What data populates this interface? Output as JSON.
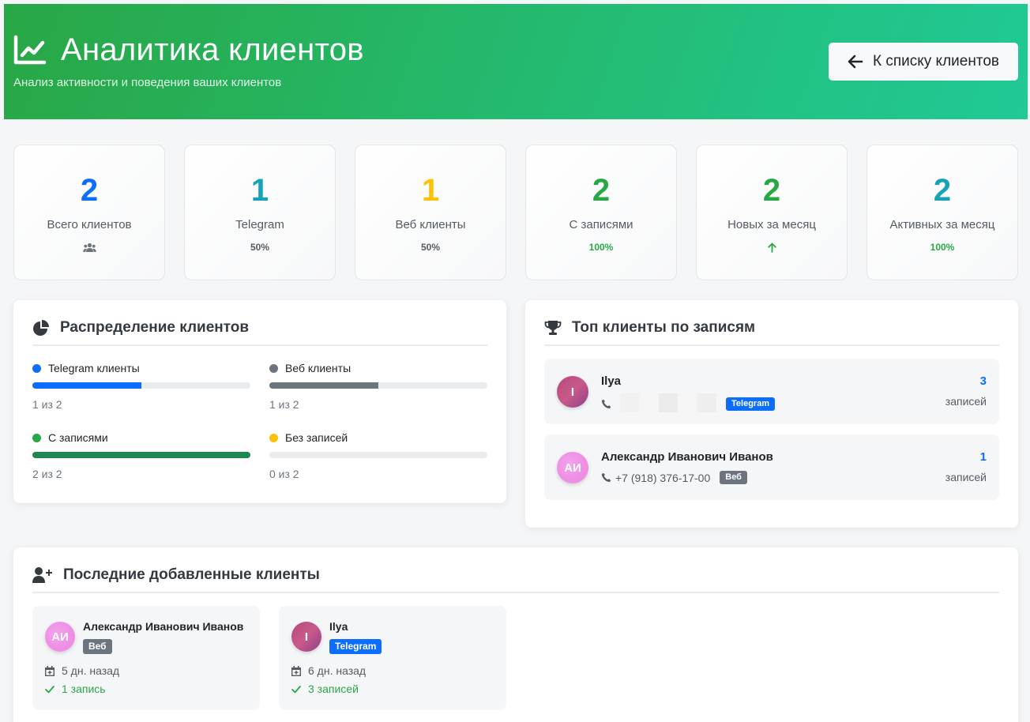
{
  "header": {
    "title": "Аналитика клиентов",
    "subtitle": "Анализ активности и поведения ваших клиентов",
    "back_button": "К списку клиентов"
  },
  "stats": [
    {
      "value": "2",
      "label": "Всего клиентов",
      "extra": "",
      "extra_icon": "users-icon",
      "color": "#0d6efd"
    },
    {
      "value": "1",
      "label": "Telegram",
      "extra": "50%",
      "color": "#17a2b8"
    },
    {
      "value": "1",
      "label": "Веб клиенты",
      "extra": "50%",
      "color": "#ffc107"
    },
    {
      "value": "2",
      "label": "С записями",
      "extra": "100%",
      "color": "#28a745"
    },
    {
      "value": "2",
      "label": "Новых за месяц",
      "extra": "",
      "extra_icon": "arrow-up-icon",
      "color": "#28a745"
    },
    {
      "value": "2",
      "label": "Активных за месяц",
      "extra": "100%",
      "color": "#17a2b8"
    }
  ],
  "distribution": {
    "title": "Распределение клиентов",
    "items": [
      {
        "label": "Telegram клиенты",
        "count": "1 из 2",
        "fraction": 0.5,
        "color": "#0d6efd"
      },
      {
        "label": "Веб клиенты",
        "count": "1 из 2",
        "fraction": 0.5,
        "color": "#6c757d"
      },
      {
        "label": "С записями",
        "count": "2 из 2",
        "fraction": 1.0,
        "color": "#1e8752",
        "dot_color": "#28a745"
      },
      {
        "label": "Без записей",
        "count": "0 из 2",
        "fraction": 0.0,
        "color": "#ffc107"
      }
    ]
  },
  "top_clients": {
    "title": "Топ клиенты по записям",
    "items": [
      {
        "initials": "I",
        "name": "Ilya",
        "phone": "",
        "phone_hidden": true,
        "badge": "Telegram",
        "count": "3",
        "count_label": "записей"
      },
      {
        "initials": "АИ",
        "name": "Александр Иванович Иванов",
        "phone": "+7 (918) 376-17-00",
        "phone_hidden": false,
        "badge": "Веб",
        "count": "1",
        "count_label": "записей"
      }
    ]
  },
  "recent_clients": {
    "title": "Последние добавленные клиенты",
    "items": [
      {
        "initials": "АИ",
        "name": "Александр Иванович Иванов",
        "badge": "Веб",
        "date": "5 дн. назад",
        "records": "1 запись"
      },
      {
        "initials": "I",
        "name": "Ilya",
        "badge": "Telegram",
        "date": "6 дн. назад",
        "records": "3 записей"
      }
    ]
  }
}
